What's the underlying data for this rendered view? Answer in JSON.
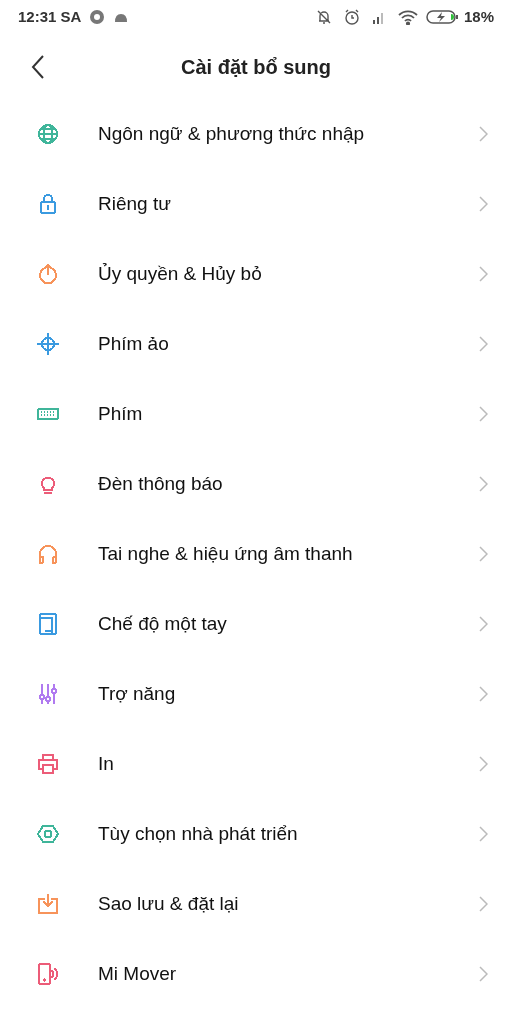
{
  "status_bar": {
    "time": "12:31 SA",
    "battery": "18%"
  },
  "header": {
    "title": "Cài đặt bổ sung"
  },
  "items": [
    {
      "label": "Ngôn ngữ & phương thức nhập",
      "kind": "globe",
      "color": "#3fb59a"
    },
    {
      "label": "Riêng tư",
      "kind": "lock",
      "color": "#3a9ae0"
    },
    {
      "label": "Ủy quyền & Hủy bỏ",
      "kind": "power",
      "color": "#f7935a"
    },
    {
      "label": "Phím ảo",
      "kind": "crosshair",
      "color": "#3a9ae0"
    },
    {
      "label": "Phím",
      "kind": "keyboard",
      "color": "#3fb59a"
    },
    {
      "label": "Đèn thông báo",
      "kind": "bulb",
      "color": "#ec5c78"
    },
    {
      "label": "Tai nghe & hiệu ứng âm thanh",
      "kind": "headphones",
      "color": "#f7935a"
    },
    {
      "label": "Chế độ một tay",
      "kind": "tablet",
      "color": "#3a9ae0"
    },
    {
      "label": "Trợ năng",
      "kind": "sliders",
      "color": "#b07af0"
    },
    {
      "label": "In",
      "kind": "printer",
      "color": "#ec5c78"
    },
    {
      "label": "Tùy chọn nhà phát triển",
      "kind": "nut",
      "color": "#3fb59a"
    },
    {
      "label": "Sao lưu & đặt lại",
      "kind": "download",
      "color": "#f7935a"
    },
    {
      "label": "Mi Mover",
      "kind": "phone",
      "color": "#ec5c78"
    }
  ]
}
